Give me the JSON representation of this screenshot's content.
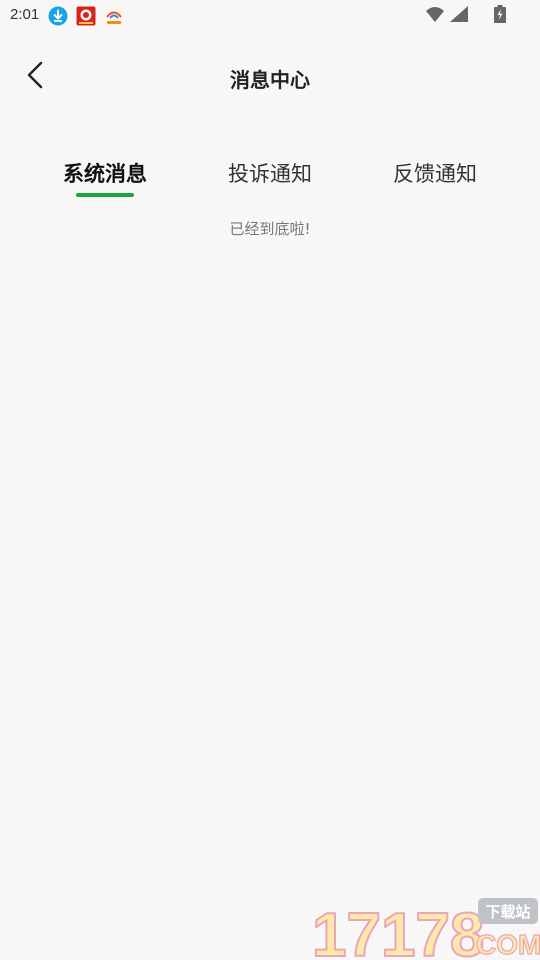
{
  "status_bar": {
    "time": "2:01",
    "icons": [
      "download-icon",
      "app-icon",
      "app-icon",
      "wifi-icon",
      "signal-icon",
      "battery-icon"
    ]
  },
  "header": {
    "title": "消息中心",
    "back_icon": "chevron-left-icon"
  },
  "tabs": [
    {
      "label": "系统消息",
      "active": true
    },
    {
      "label": "投诉通知",
      "active": false
    },
    {
      "label": "反馈通知",
      "active": false
    }
  ],
  "list": {
    "end_text": "已经到底啦!"
  },
  "watermark": {
    "number": "17178",
    "badge": "下载站",
    "suffix": "COM"
  },
  "colors": {
    "background": "#f7f7f7",
    "accent": "#1aa83a",
    "title": "#222222",
    "muted": "#777777"
  }
}
